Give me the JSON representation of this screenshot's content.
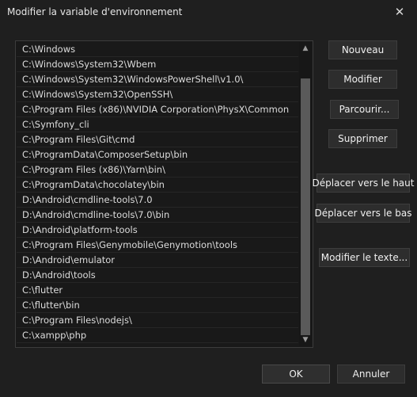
{
  "window": {
    "title": "Modifier la variable d'environnement",
    "close_icon": "close-icon"
  },
  "path_list": {
    "items": [
      "C:\\Windows",
      "C:\\Windows\\System32\\Wbem",
      "C:\\Windows\\System32\\WindowsPowerShell\\v1.0\\",
      "C:\\Windows\\System32\\OpenSSH\\",
      "C:\\Program Files (x86)\\NVIDIA Corporation\\PhysX\\Common",
      "C:\\Symfony_cli",
      "C:\\Program Files\\Git\\cmd",
      "C:\\ProgramData\\ComposerSetup\\bin",
      "C:\\Program Files (x86)\\Yarn\\bin\\",
      "C:\\ProgramData\\chocolatey\\bin",
      "D:\\Android\\cmdline-tools\\7.0",
      "D:\\Android\\cmdline-tools\\7.0\\bin",
      "D:\\Android\\platform-tools",
      "C:\\Program Files\\Genymobile\\Genymotion\\tools",
      "D:\\Android\\emulator",
      "D:\\Android\\tools",
      "C:\\flutter",
      "C:\\flutter\\bin",
      "C:\\Program Files\\nodejs\\",
      "C:\\xampp\\php"
    ]
  },
  "buttons": {
    "nouveau": "Nouveau",
    "modifier": "Modifier",
    "parcourir": "Parcourir...",
    "supprimer": "Supprimer",
    "deplacer_haut": "Déplacer vers le haut",
    "deplacer_bas": "Déplacer vers le bas",
    "modifier_texte": "Modifier le texte...",
    "ok": "OK",
    "annuler": "Annuler"
  },
  "colors": {
    "background": "#1f1f1f",
    "button": "#2d2d2d",
    "text": "#e6e6e6"
  }
}
